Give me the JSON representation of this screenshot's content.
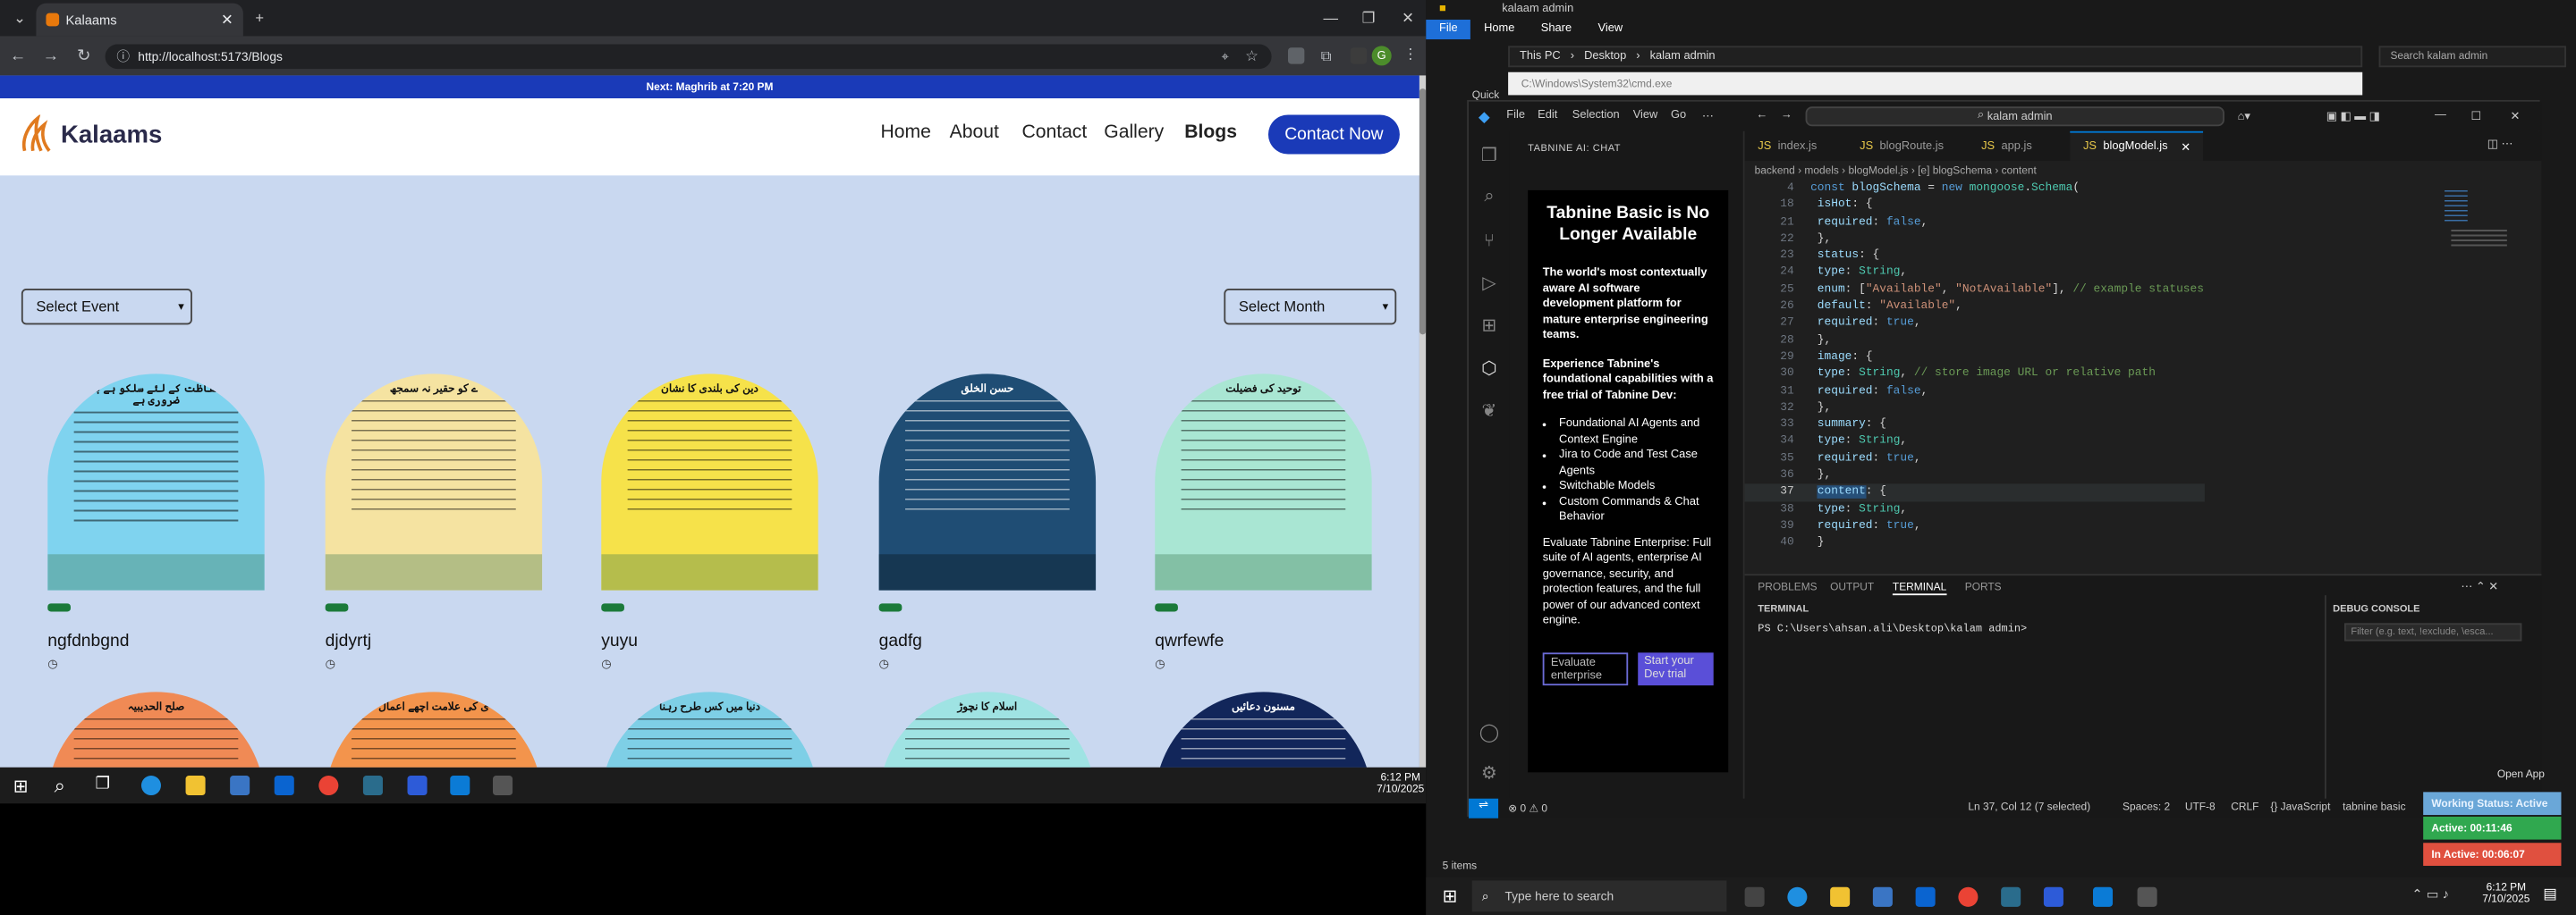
{
  "browser": {
    "tab_title": "Kalaams",
    "url": "http://localhost:5173/Blogs",
    "profile_initial": "G"
  },
  "site": {
    "prayer_bar": "Next: Maghrib at 7:20 PM",
    "logo_text": "Kalaams",
    "nav": [
      "Home",
      "About",
      "Contact",
      "Gallery",
      "Blogs"
    ],
    "contact_button": "Contact Now",
    "select_event": "Select Event",
    "select_month": "Select Month",
    "cards": [
      {
        "arch_title": "کی حفاظت کے لئے سلکو ہے بچنا ضروری ہے",
        "title": "ngfdnbgnd",
        "color": "#7fd3ef"
      },
      {
        "arch_title": "ے کو حقیر نہ سمجھ",
        "title": "djdyrtj",
        "color": "#f5e3a1"
      },
      {
        "arch_title": "دین کی بلندی کا نشان",
        "title": "yuyu",
        "color": "#f6e24a"
      },
      {
        "arch_title": "حسن الخلق",
        "title": "gadfg",
        "color": "#1f4d74"
      },
      {
        "arch_title": "توحید کی فضیلت",
        "title": "qwrfewfe",
        "color": "#a9e6d3"
      }
    ],
    "cards_row2": [
      {
        "arch_title": "صلح الحدیبیہ",
        "color": "#f08a55"
      },
      {
        "arch_title": "ی کی علامت اچھے اعمال",
        "color": "#f3944c"
      },
      {
        "arch_title": "دنیا میں کس طرح رہنا",
        "color": "#7ecfe6"
      },
      {
        "arch_title": "اسلام کا نچوڑ",
        "color": "#9fe3e3"
      },
      {
        "arch_title": "مسنون دعائیں",
        "color": "#12265a"
      }
    ]
  },
  "explorer": {
    "title": "kalaam admin",
    "ribbon": [
      "File",
      "Home",
      "Share",
      "View"
    ],
    "path": [
      "This PC",
      "Desktop",
      "kalam admin"
    ],
    "search_placeholder": "Search kalam admin",
    "items_count": "5 items",
    "cmd_title": "C:\\Windows\\System32\\cmd.exe",
    "quick": "Quick"
  },
  "vscode": {
    "menu": [
      "File",
      "Edit",
      "Selection",
      "View",
      "Go"
    ],
    "search": "kalam admin",
    "chat_title": "TABNINE AI: CHAT",
    "tabnine": {
      "heading": "Tabnine Basic is No Longer Available",
      "p1": "The world's most contextually aware AI software development platform for mature enterprise engineering teams.",
      "p2": "Experience Tabnine's foundational capabilities with a free trial of Tabnine Dev:",
      "bullets": [
        "Foundational AI Agents and Context Engine",
        "Jira to Code and Test Case Agents",
        "Switchable Models",
        "Custom Commands & Chat Behavior"
      ],
      "p3": "Evaluate Tabnine Enterprise: Full suite of AI agents, enterprise AI governance, security, and protection features, and the full power of our advanced context engine.",
      "btn1": "Evaluate enterprise",
      "btn2": "Start your Dev trial"
    },
    "tabs": [
      "index.js",
      "blogRoute.js",
      "app.js",
      "blogModel.js"
    ],
    "breadcrumb": "backend › models › blogModel.js › [e] blogSchema › content",
    "panel_tabs": [
      "PROBLEMS",
      "OUTPUT",
      "TERMINAL",
      "PORTS"
    ],
    "terminal_label": "TERMINAL",
    "terminal_prompt": "PS C:\\Users\\ahsan.ali\\Desktop\\kalam admin>",
    "debug_label": "DEBUG CONSOLE",
    "debug_filter": "Filter (e.g. text, !exclude, \\esca...",
    "status_left": "⊗ 0 ⚠ 0",
    "status_pos": "Ln 37, Col 12 (7 selected)",
    "status_spaces": "Spaces: 2",
    "status_enc": "UTF-8",
    "status_eol": "CRLF",
    "status_lang": "{} JavaScript",
    "status_tabnine": "tabnine basic"
  },
  "overlay": {
    "open_app": "Open App",
    "working": "Working Status: Active",
    "active": "Active: 00:11:46",
    "inactive": "In Active: 00:06:07"
  },
  "taskbar": {
    "time": "6:12 PM",
    "date": "7/10/2025",
    "search_placeholder": "Type here to search"
  }
}
